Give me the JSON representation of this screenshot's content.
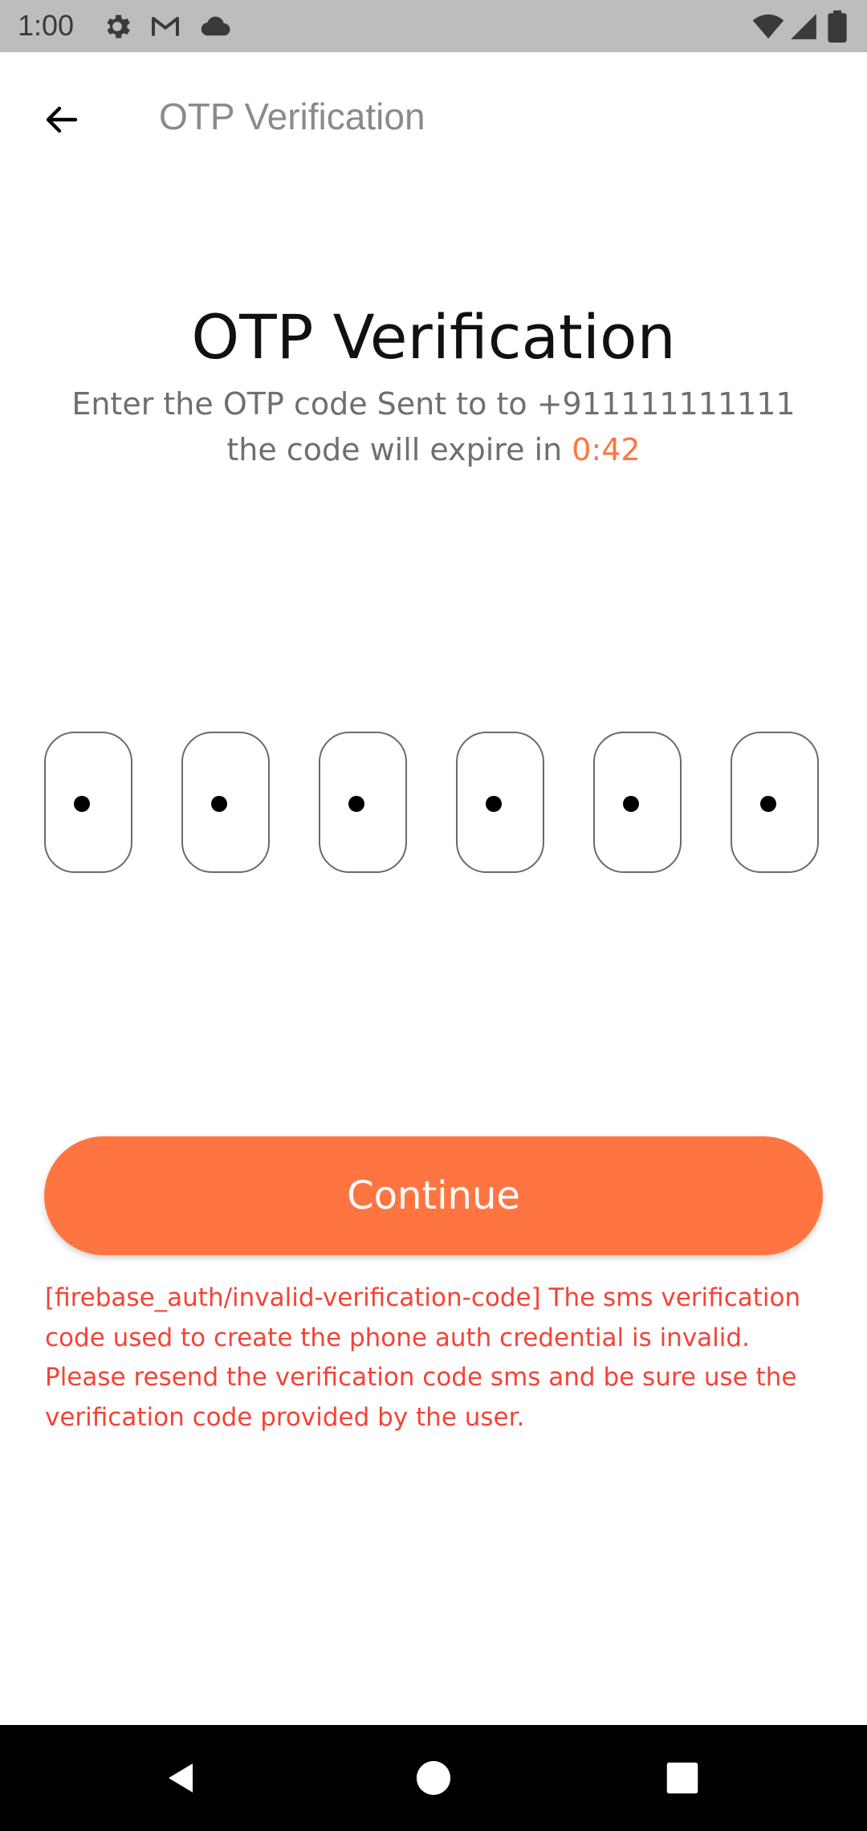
{
  "status_bar": {
    "time": "1:00",
    "left_icons": [
      "gear-icon",
      "gmail-icon",
      "cloud-icon"
    ],
    "right_icons": [
      "wifi-icon",
      "signal-icon",
      "battery-icon"
    ]
  },
  "app_bar": {
    "back_icon": "arrow-left-icon",
    "title": "OTP Verification"
  },
  "main": {
    "heading": "OTP Verification",
    "subtext_line1": "Enter the OTP code Sent to to +911111111111",
    "subtext_line2_prefix": "the code will expire in ",
    "timer": "0:42",
    "otp": {
      "length": 6,
      "digits": [
        "•",
        "•",
        "•",
        "•",
        "•",
        "•"
      ]
    },
    "continue_label": "Continue",
    "error_lines": [
      "[firebase_auth/invalid-verification-code] The sms verification",
      "code used to create the phone auth credential is invalid.",
      "Please resend the verification code sms and be sure use the",
      "verification code provided by the user."
    ]
  },
  "nav_bar": {
    "icons": [
      "back-triangle-icon",
      "home-circle-icon",
      "recents-square-icon"
    ]
  },
  "colors": {
    "accent": "#ff7542",
    "error": "#f44336",
    "status_bar": "#bdbdbd",
    "nav_bar": "#000000"
  }
}
